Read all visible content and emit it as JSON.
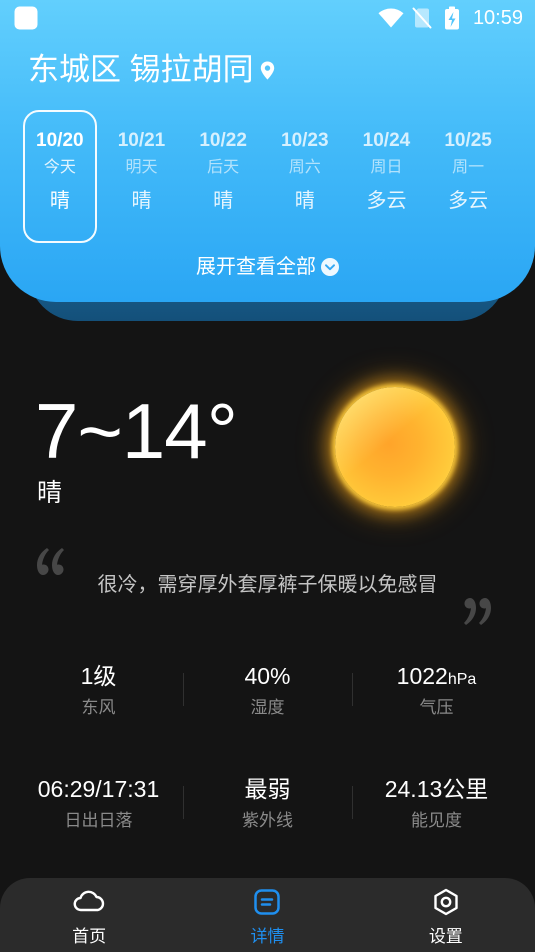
{
  "status_bar": {
    "time": "10:59",
    "icons": [
      "app-notification-icon",
      "wifi-icon",
      "no-sim-icon",
      "battery-charging-icon"
    ]
  },
  "location": {
    "name": "东城区 锡拉胡同",
    "icon": "location-pin-icon"
  },
  "forecast": {
    "days": [
      {
        "date": "10/20",
        "weekday": "今天",
        "weather": "晴",
        "selected": true
      },
      {
        "date": "10/21",
        "weekday": "明天",
        "weather": "晴",
        "selected": false
      },
      {
        "date": "10/22",
        "weekday": "后天",
        "weather": "晴",
        "selected": false
      },
      {
        "date": "10/23",
        "weekday": "周六",
        "weather": "晴",
        "selected": false
      },
      {
        "date": "10/24",
        "weekday": "周日",
        "weather": "多云",
        "selected": false
      },
      {
        "date": "10/25",
        "weekday": "周一",
        "weather": "多云",
        "selected": false
      }
    ],
    "expand_label": "展开查看全部",
    "expand_icon": "chevron-down-circle-icon"
  },
  "current": {
    "temperature": "7~14°",
    "condition": "晴",
    "icon": "sun-icon"
  },
  "advice": {
    "text": "很冷，需穿厚外套厚裤子保暖以免感冒",
    "icons": [
      "open-quote-icon",
      "close-quote-icon"
    ]
  },
  "stats": [
    {
      "value": "1级",
      "label": "东风"
    },
    {
      "value": "40%",
      "label": "湿度"
    },
    {
      "value": "1022",
      "unit": "hPa",
      "label": "气压"
    },
    {
      "value": "06:29/17:31",
      "label": "日出日落"
    },
    {
      "value": "最弱",
      "label": "紫外线"
    },
    {
      "value": "24.13公里",
      "label": "能见度"
    }
  ],
  "nav": {
    "items": [
      {
        "label": "首页",
        "icon": "cloud-icon",
        "active": false
      },
      {
        "label": "详情",
        "icon": "details-icon",
        "active": true
      },
      {
        "label": "设置",
        "icon": "settings-icon",
        "active": false
      }
    ]
  },
  "colors": {
    "header_top": "#62cffd",
    "header_bottom": "#2aa6f4",
    "accent": "#1f8fef",
    "background": "#141414",
    "nav_background": "#2b2b2b",
    "muted_text": "#8a8a8a"
  }
}
